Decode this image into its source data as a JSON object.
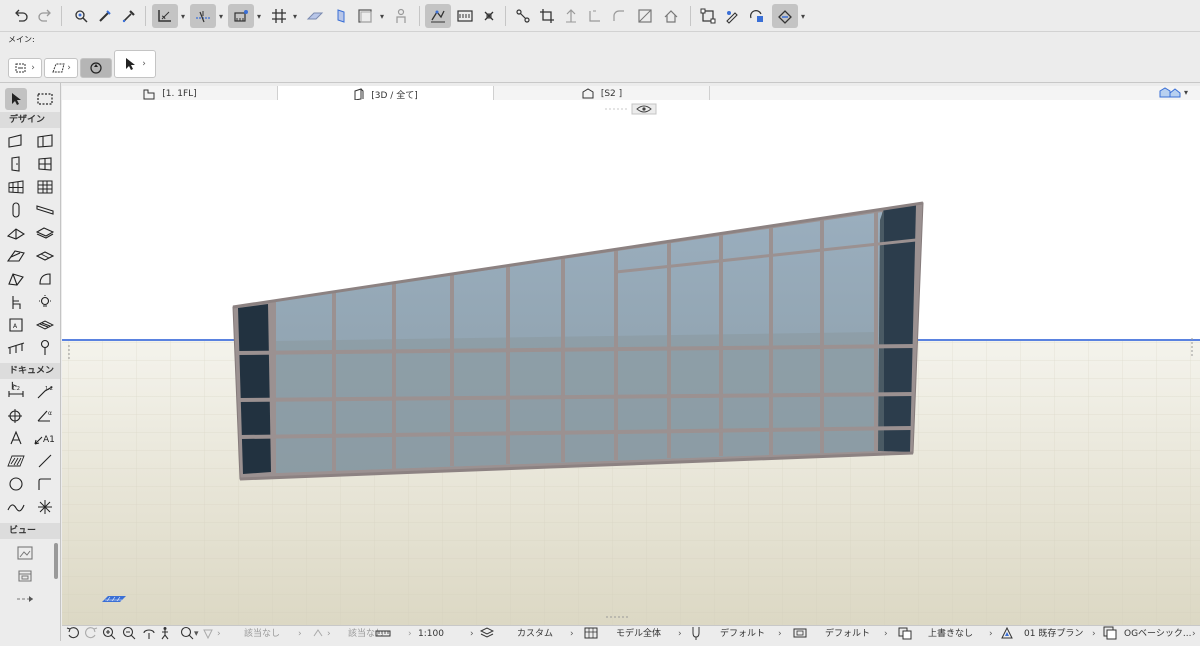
{
  "toolbar": {
    "icons": [
      "undo-icon",
      "redo-icon",
      "pick-up-icon",
      "inject-icon",
      "eyedropper-icon",
      "layout-icon",
      "snap-guides-icon",
      "ruler-icon",
      "grid-icon",
      "slab-icon",
      "door-icon",
      "shape-icon",
      "person-icon",
      "floor-plan-icon",
      "dimension-icon",
      "snap-point-icon",
      "connect-icon",
      "crop-icon",
      "elevation-icon",
      "angle-icon",
      "corner-icon",
      "fill-icon",
      "roof-icon",
      "select-group-icon",
      "edit-icon",
      "trace-icon",
      "render-icon"
    ]
  },
  "infobox": {
    "main_label": "メイン:"
  },
  "toolbox": {
    "design_label": "デザイン",
    "document_label": "ドキュメント",
    "view_label": "ビュー"
  },
  "tabs": {
    "tab1": "[1. 1FL]",
    "tab2": "[3D / 全て]",
    "tab3": "[S2 ]"
  },
  "status": {
    "na1": "該当なし",
    "na2": "該当なし",
    "scale": "1:100",
    "layer": "カスタム",
    "model": "モデル全体",
    "pen": "デフォルト",
    "display": "デフォルト",
    "override": "上書きなし",
    "reno": "01 既存プラン",
    "graphic": "OGベーシック..."
  },
  "colors": {
    "accent_blue": "#3a6fd6",
    "glass": "#8fa2b1",
    "mullion": "#9a9191",
    "dark_panel": "#223240",
    "ground": "#e5e2d4"
  }
}
